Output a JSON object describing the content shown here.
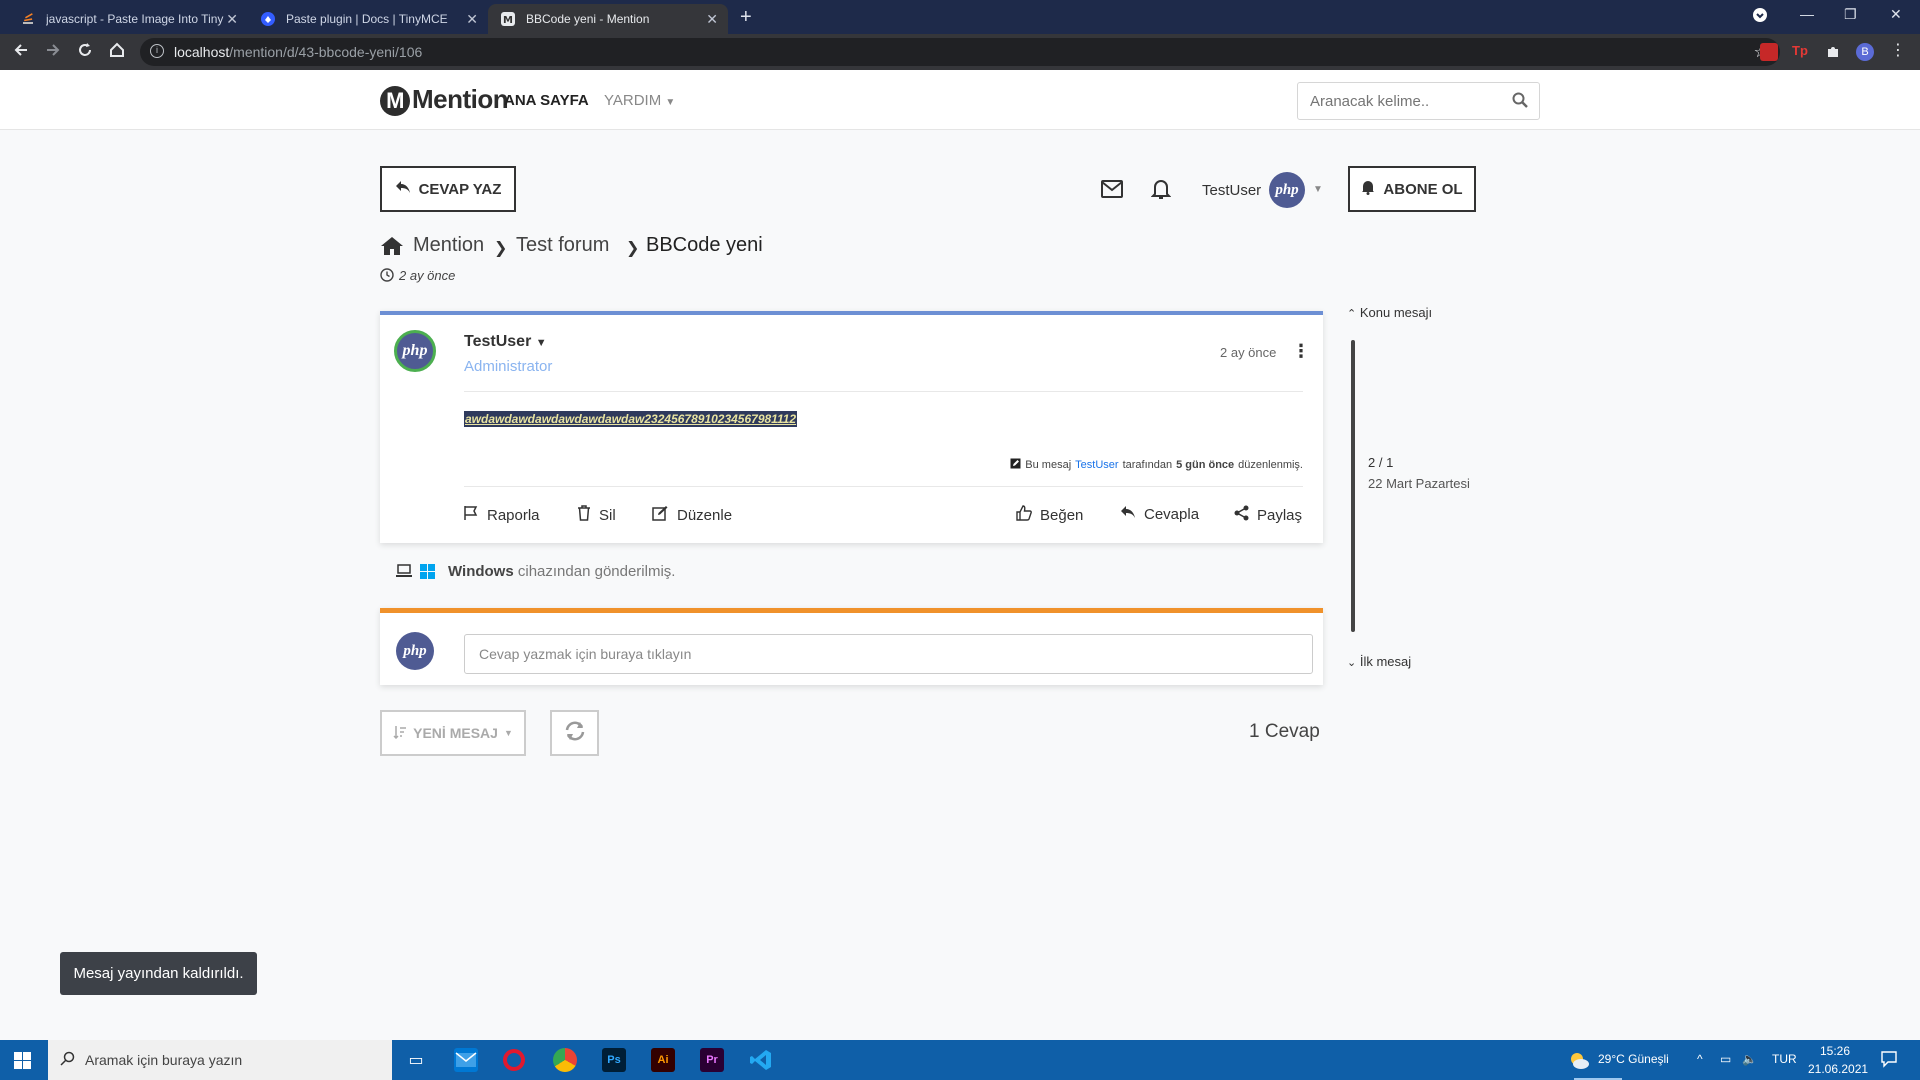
{
  "browser": {
    "tabs": [
      {
        "title": "javascript - Paste Image Into Tiny",
        "active": false
      },
      {
        "title": "Paste plugin | Docs | TinyMCE",
        "active": false
      },
      {
        "title": "BBCode yeni - Mention",
        "active": true
      }
    ],
    "url_host": "localhost",
    "url_path": "/mention/d/43-bbcode-yeni/106",
    "profile_initial": "B"
  },
  "header": {
    "logo": "Mention",
    "logo_letter": "M",
    "nav": {
      "home": "ANA SAYFA",
      "help": "YARDIM"
    },
    "search_placeholder": "Aranacak kelime.."
  },
  "actions": {
    "reply_button": "CEVAP YAZ",
    "subscribe_button": "ABONE OL",
    "username": "TestUser"
  },
  "breadcrumb": {
    "items": [
      "Mention",
      "Test forum",
      "BBCode yeni"
    ],
    "time": "2 ay önce"
  },
  "post": {
    "author": "TestUser",
    "role": "Administrator",
    "time": "2 ay önce",
    "content": "awdawdawdawdawdawdawdaw23245678910234567981112",
    "edit_prefix": "Bu mesaj",
    "edit_user": "TestUser",
    "edit_middle": "tarafından",
    "edit_when": "5 gün önce",
    "edit_suffix": "düzenlenmiş.",
    "actions": {
      "report": "Raporla",
      "delete": "Sil",
      "edit": "Düzenle",
      "like": "Beğen",
      "reply": "Cevapla",
      "share": "Paylaş"
    },
    "device_os": "Windows",
    "device_suffix": "cihazından gönderilmiş."
  },
  "reply_box": {
    "placeholder": "Cevap yazmak için buraya tıklayın"
  },
  "footer": {
    "new_message": "YENİ MESAJ",
    "reply_count": "1 Cevap"
  },
  "timeline": {
    "top": "Konu mesajı",
    "position": "2 / 1",
    "date": "22 Mart Pazartesi",
    "bottom": "İlk mesaj"
  },
  "avatar_text": "php",
  "toast": "Mesaj yayından kaldırıldı.",
  "taskbar": {
    "search_placeholder": "Aramak için buraya yazın",
    "weather": "29°C  Güneşli",
    "lang": "TUR",
    "time": "15:26",
    "date": "21.06.2021"
  },
  "colors": {
    "accent_blue": "#6d8fd4",
    "accent_orange": "#f0922b",
    "role_color": "#8ab4f0",
    "link_blue": "#1a73e8",
    "taskbar": "#0f5fa8"
  }
}
